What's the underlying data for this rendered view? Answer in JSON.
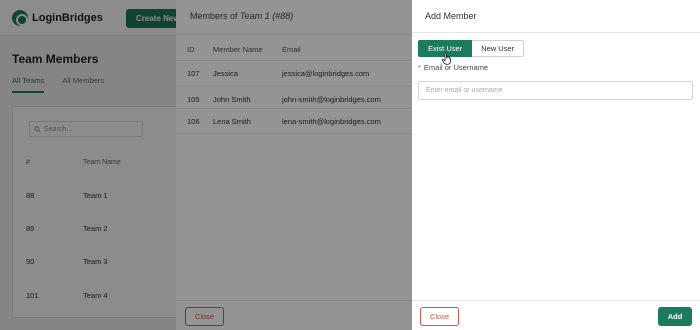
{
  "app": {
    "logo_text": "LoginBridges",
    "create_label": "Create New"
  },
  "page": {
    "title": "Team Members",
    "tabs": [
      {
        "label": "All Teams",
        "active": true
      },
      {
        "label": "All Members",
        "active": false
      }
    ],
    "search_placeholder": "Search...",
    "table_headers": {
      "num": "#",
      "name": "Team Name"
    },
    "rows": [
      {
        "num": "88",
        "name": "Team 1"
      },
      {
        "num": "89",
        "name": "Team 2"
      },
      {
        "num": "90",
        "name": "Team 3"
      },
      {
        "num": "101",
        "name": "Team 4"
      }
    ]
  },
  "members_drawer": {
    "title_prefix": "Members of ",
    "title_team": "Team 1 (#88)",
    "headers": {
      "id": "ID",
      "name": "Member Name",
      "email": "Email"
    },
    "rows": [
      {
        "id": "107",
        "name": "Jessica",
        "email": "jessica@loginbridges.com"
      },
      {
        "id": "105",
        "name": "John Smith",
        "email": "john-smith@loginbridges.com"
      },
      {
        "id": "106",
        "name": "Lena Smith",
        "email": "lena-smith@loginbridges.com"
      }
    ],
    "close_label": "Close"
  },
  "add_drawer": {
    "title": "Add Member",
    "toggle": {
      "exist_label": "Exist User",
      "new_label": "New User",
      "selected": "Exist User"
    },
    "required_mark": "*",
    "field_label": "Email or Username",
    "field_placeholder": "Enter email or username",
    "field_value": "",
    "close_label": "Close",
    "add_label": "Add"
  },
  "colors": {
    "accent": "#1c7a5e",
    "danger": "#d9534f"
  }
}
